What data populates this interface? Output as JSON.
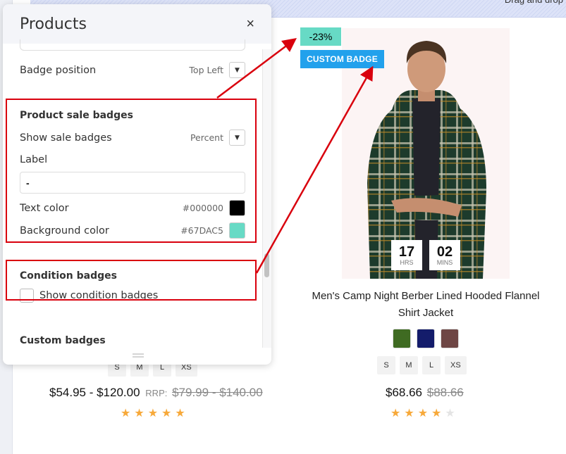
{
  "background": {
    "dropzone_label": "Drag and drop"
  },
  "product_left": {
    "sizes": [
      "S",
      "M",
      "L",
      "XS"
    ],
    "price": "$54.95 - $120.00",
    "rrp_label": "RRP:",
    "old_price": "$79.99 - $140.00",
    "rating": 5,
    "rating_max": 5
  },
  "product_right": {
    "sale_badge": "-23%",
    "custom_badge": "CUSTOM BADGE",
    "timer": [
      {
        "value": "17",
        "unit": "HRS"
      },
      {
        "value": "02",
        "unit": "MINS"
      }
    ],
    "title": "Men's Camp Night Berber Lined Hooded Flannel Shirt Jacket",
    "swatches": [
      "#3f6b22",
      "#141c6b",
      "#6e4644"
    ],
    "sizes": [
      "S",
      "M",
      "L",
      "XS"
    ],
    "price": "$68.66",
    "old_price": "$88.66",
    "rating": 4,
    "rating_max": 5
  },
  "panel": {
    "title": "Products",
    "close_icon": "×",
    "badge_position": {
      "label": "Badge position",
      "value": "Top Left"
    },
    "sale_badges": {
      "title": "Product sale badges",
      "show_label": "Show sale badges",
      "show_value": "Percent",
      "label_label": "Label",
      "label_value": "-",
      "text_color_label": "Text color",
      "text_color": "#000000",
      "bg_color_label": "Background color",
      "bg_color": "#67DAC5"
    },
    "condition_badges": {
      "title": "Condition badges",
      "show_label": "Show condition badges",
      "checked": false
    },
    "custom_badges": {
      "title": "Custom badges"
    }
  },
  "colors": {
    "annotation_red": "#d9000d",
    "custom_badge_bg": "#22a1ec",
    "star": "#f7a93a"
  }
}
